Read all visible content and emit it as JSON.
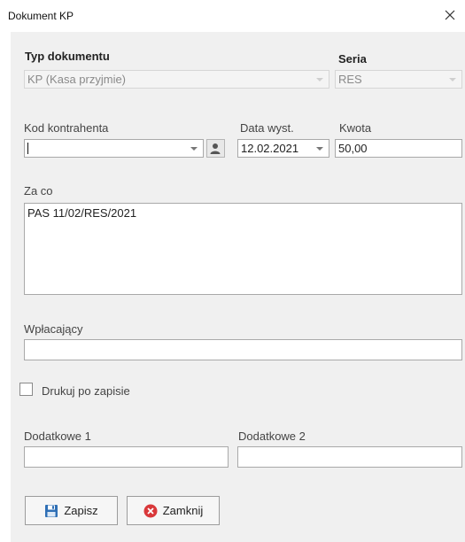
{
  "window": {
    "title": "Dokument KP",
    "close_icon": "close-icon"
  },
  "form": {
    "typ_dokumentu": {
      "label": "Typ dokumentu",
      "value": "KP (Kasa przyjmie)"
    },
    "seria": {
      "label": "Seria",
      "value": "RES"
    },
    "kod_kontrahenta": {
      "label": "Kod kontrahenta",
      "value": ""
    },
    "data_wyst": {
      "label": "Data wyst.",
      "value": "12.02.2021"
    },
    "kwota": {
      "label": "Kwota",
      "value": "50,00"
    },
    "za_co": {
      "label": "Za co",
      "value": "PAS 11/02/RES/2021"
    },
    "wplacajacy": {
      "label": "Wpłacający",
      "value": ""
    },
    "drukuj": {
      "label": "Drukuj po zapisie",
      "checked": false
    },
    "dodatkowe1": {
      "label": "Dodatkowe 1",
      "value": ""
    },
    "dodatkowe2": {
      "label": "Dodatkowe 2",
      "value": ""
    }
  },
  "buttons": {
    "save": {
      "label": "Zapisz",
      "icon": "floppy-disk-icon",
      "icon_color": "#2f6fb5"
    },
    "close": {
      "label": "Zamknij",
      "icon": "close-circle-icon",
      "icon_color": "#d9383a"
    }
  },
  "colors": {
    "panel_bg": "#f0f0f0",
    "disabled_text": "#8a8a8a"
  }
}
